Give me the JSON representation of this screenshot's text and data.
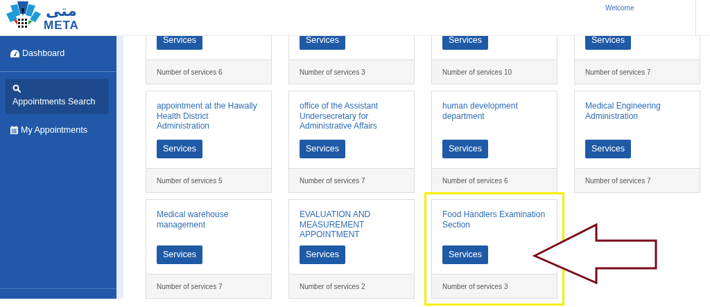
{
  "header": {
    "logo_arabic": "متى",
    "logo_latin": "META",
    "welcome": "Welcome"
  },
  "sidebar": {
    "items": [
      {
        "label": "Dashboard",
        "selected": false
      },
      {
        "label": "Appointments Search",
        "selected": true
      },
      {
        "label": "My Appointments",
        "selected": false
      }
    ]
  },
  "cards": [
    {
      "button": "Services",
      "count": "Number of services 6",
      "highlighted": false
    },
    {
      "button": "Services",
      "count": "Number of services 3",
      "highlighted": false
    },
    {
      "button": "Services",
      "count": "Number of services 10",
      "highlighted": false
    },
    {
      "button": "Services",
      "count": "Number of services 7",
      "highlighted": false
    },
    {
      "title": "appointment at the Hawally Health District Administration",
      "button": "Services",
      "count": "Number of services 5",
      "highlighted": false
    },
    {
      "title": "office of the Assistant Undersecretary for Administrative Affairs",
      "button": "Services",
      "count": "Number of services 7",
      "highlighted": false
    },
    {
      "title": "human development department",
      "button": "Services",
      "count": "Number of services 6",
      "highlighted": false
    },
    {
      "title": "Medical Engineering Administration",
      "button": "Services",
      "count": "Number of services 7",
      "highlighted": false
    },
    {
      "title": "Medical warehouse management",
      "button": "Services",
      "count": "Number of services 7",
      "highlighted": false
    },
    {
      "title": "EVALUATION AND MEASUREMENT APPOINTMENT",
      "button": "Services",
      "count": "Number of services 2",
      "highlighted": false
    },
    {
      "title": "Food Handlers Examination Section",
      "button": "Services",
      "count": "Number of services 3",
      "highlighted": true
    }
  ]
}
